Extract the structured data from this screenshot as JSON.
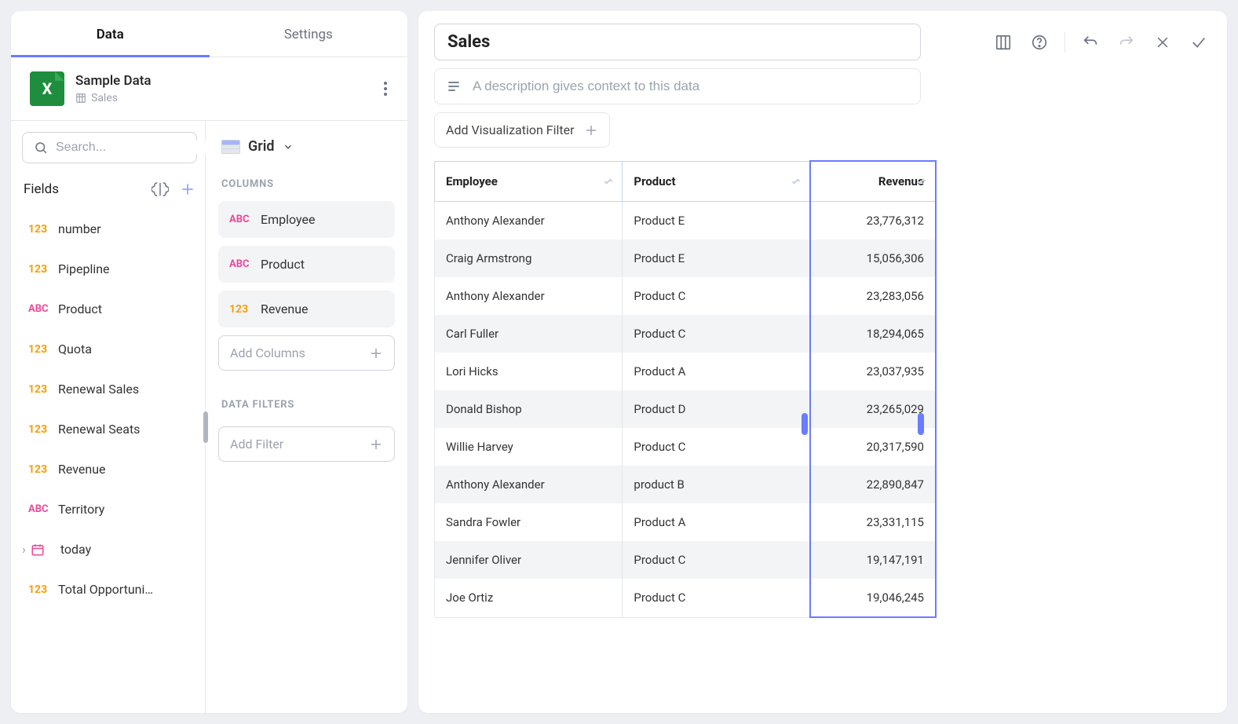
{
  "tabs": {
    "data": "Data",
    "settings": "Settings"
  },
  "datasource": {
    "title": "Sample Data",
    "subtitle": "Sales",
    "icon_letter": "X"
  },
  "search": {
    "placeholder": "Search..."
  },
  "fields": {
    "header": "Fields",
    "items": [
      {
        "type": "123",
        "label": "number"
      },
      {
        "type": "123",
        "label": "Pipepline"
      },
      {
        "type": "ABC",
        "label": "Product"
      },
      {
        "type": "123",
        "label": "Quota"
      },
      {
        "type": "123",
        "label": "Renewal Sales"
      },
      {
        "type": "123",
        "label": "Renewal Seats"
      },
      {
        "type": "123",
        "label": "Revenue"
      },
      {
        "type": "ABC",
        "label": "Territory"
      },
      {
        "type": "date",
        "label": "today",
        "expandable": true
      },
      {
        "type": "123",
        "label": "Total Opportuni…"
      }
    ]
  },
  "viz": {
    "selector": "Grid",
    "columns_label": "COLUMNS",
    "columns": [
      {
        "type": "ABC",
        "label": "Employee"
      },
      {
        "type": "ABC",
        "label": "Product"
      },
      {
        "type": "123",
        "label": "Revenue"
      }
    ],
    "add_columns": "Add Columns",
    "filters_label": "DATA FILTERS",
    "add_filter": "Add Filter"
  },
  "main": {
    "title": "Sales",
    "description_placeholder": "A description gives context to this data",
    "add_viz_filter": "Add Visualization Filter"
  },
  "table": {
    "headers": [
      "Employee",
      "Product",
      "Revenue"
    ],
    "rows": [
      [
        "Anthony Alexander",
        "Product E",
        "23,776,312"
      ],
      [
        "Craig Armstrong",
        "Product E",
        "15,056,306"
      ],
      [
        "Anthony Alexander",
        "Product C",
        "23,283,056"
      ],
      [
        "Carl Fuller",
        "Product C",
        "18,294,065"
      ],
      [
        "Lori Hicks",
        "Product A",
        "23,037,935"
      ],
      [
        "Donald Bishop",
        "Product D",
        "23,265,029"
      ],
      [
        "Willie Harvey",
        "Product C",
        "20,317,590"
      ],
      [
        "Anthony Alexander",
        "product B",
        "22,890,847"
      ],
      [
        "Sandra Fowler",
        "Product A",
        "23,331,115"
      ],
      [
        "Jennifer Oliver",
        "Product C",
        "19,147,191"
      ],
      [
        "Joe Ortiz",
        "Product C",
        "19,046,245"
      ]
    ]
  }
}
